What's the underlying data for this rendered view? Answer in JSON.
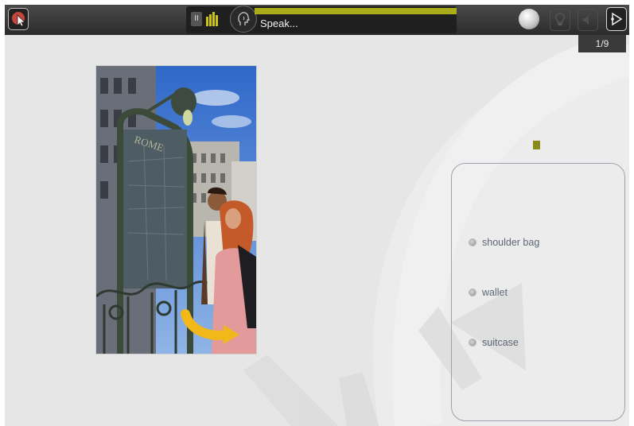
{
  "toolbar": {
    "speak_label": "Speak...",
    "pause_label": "II",
    "counter": "1/9"
  },
  "icons": {
    "exit": "exit-cursor-icon",
    "pause": "pause-icon",
    "level": "volume-level-icon",
    "voice": "head-voice-icon",
    "ball": "record-ball-icon",
    "hint": "lightbulb-icon",
    "sound": "speaker-icon",
    "next": "next-arrow-icon"
  },
  "colors": {
    "accent_yellow": "#a9ad1a",
    "exit_red": "#c8453c",
    "panel_border": "#9aa3ad",
    "marker": "#8a8a1a"
  },
  "options": [
    {
      "label": "shoulder bag"
    },
    {
      "label": "wallet"
    },
    {
      "label": "suitcase"
    }
  ]
}
